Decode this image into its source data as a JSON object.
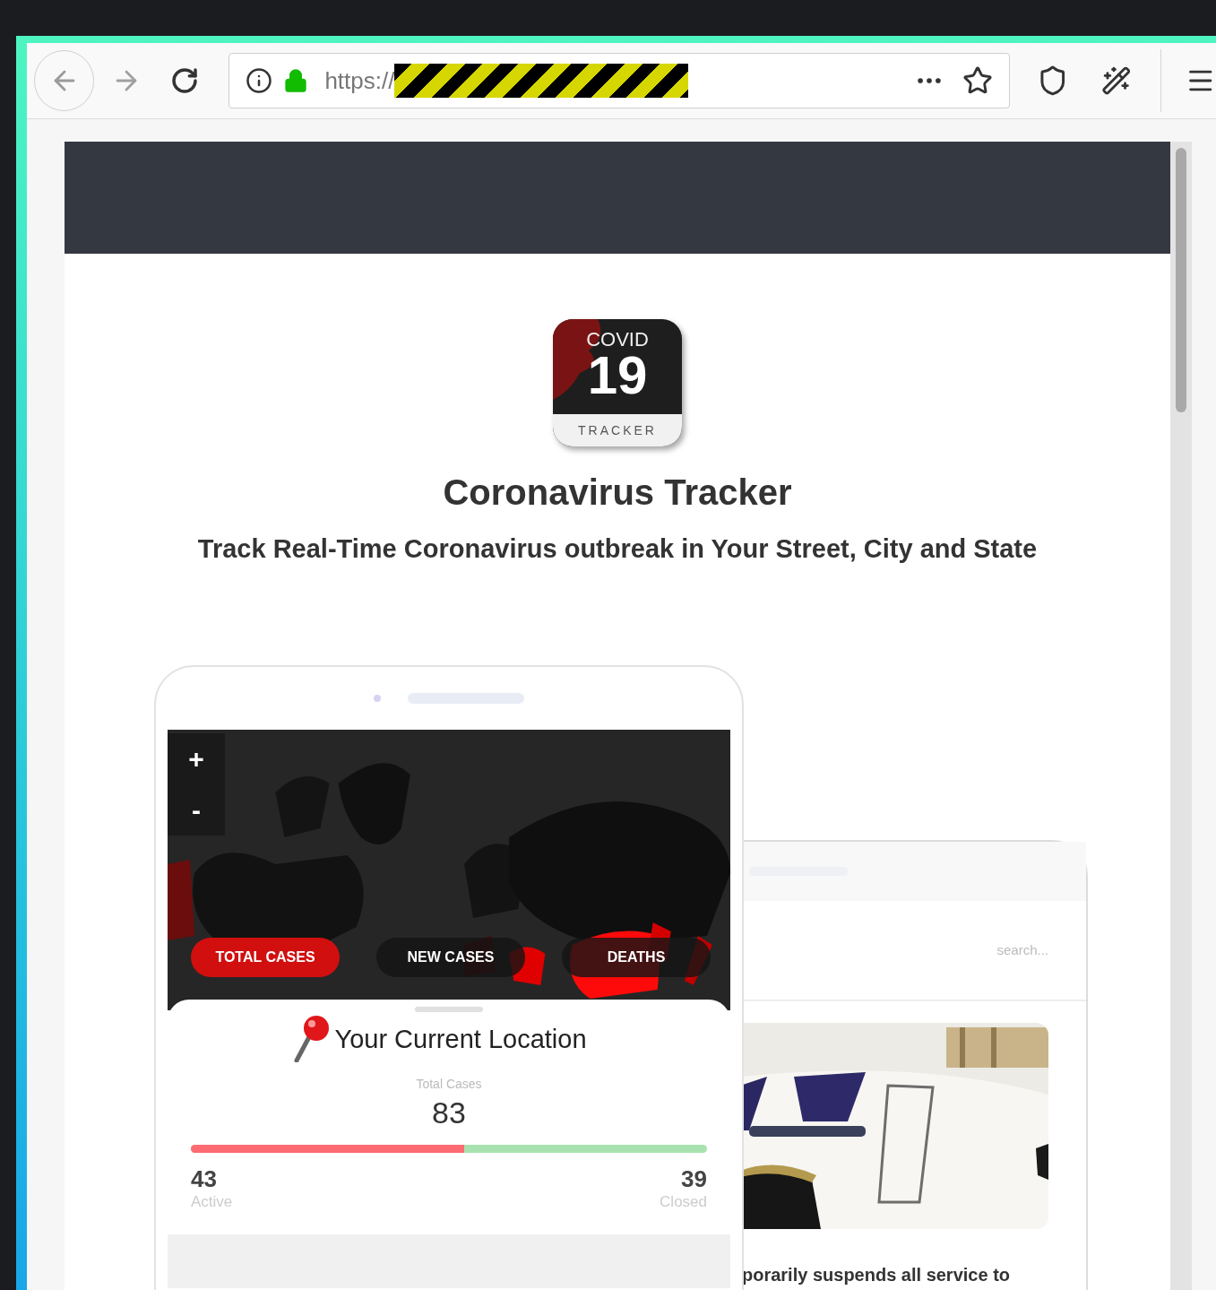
{
  "browser": {
    "url": "https://"
  },
  "page": {
    "app_icon": {
      "line_1": "COVID",
      "line_2": "19",
      "line_3": "TRACKER"
    },
    "title": "Coronavirus Tracker",
    "subtitle": "Track Real-Time Coronavirus outbreak in Your Street, City and State"
  },
  "phone_main": {
    "zoom_buttons": [
      "+",
      "-"
    ],
    "map_tabs": [
      {
        "label": "TOTAL CASES",
        "selected": true
      },
      {
        "label": "NEW CASES",
        "selected": false
      },
      {
        "label": "DEATHS",
        "selected": false
      }
    ],
    "location_title": "Your Current Location",
    "total_label": "Total Cases",
    "total_value": "83",
    "bar": {
      "level": 0.53
    },
    "active": {
      "value": "43",
      "label": "Active"
    },
    "closed": {
      "value": "39",
      "label": "Closed"
    }
  },
  "phone_news": {
    "search": {
      "placeholder": "search..."
    },
    "headline": "porarily suspends all service to"
  }
}
